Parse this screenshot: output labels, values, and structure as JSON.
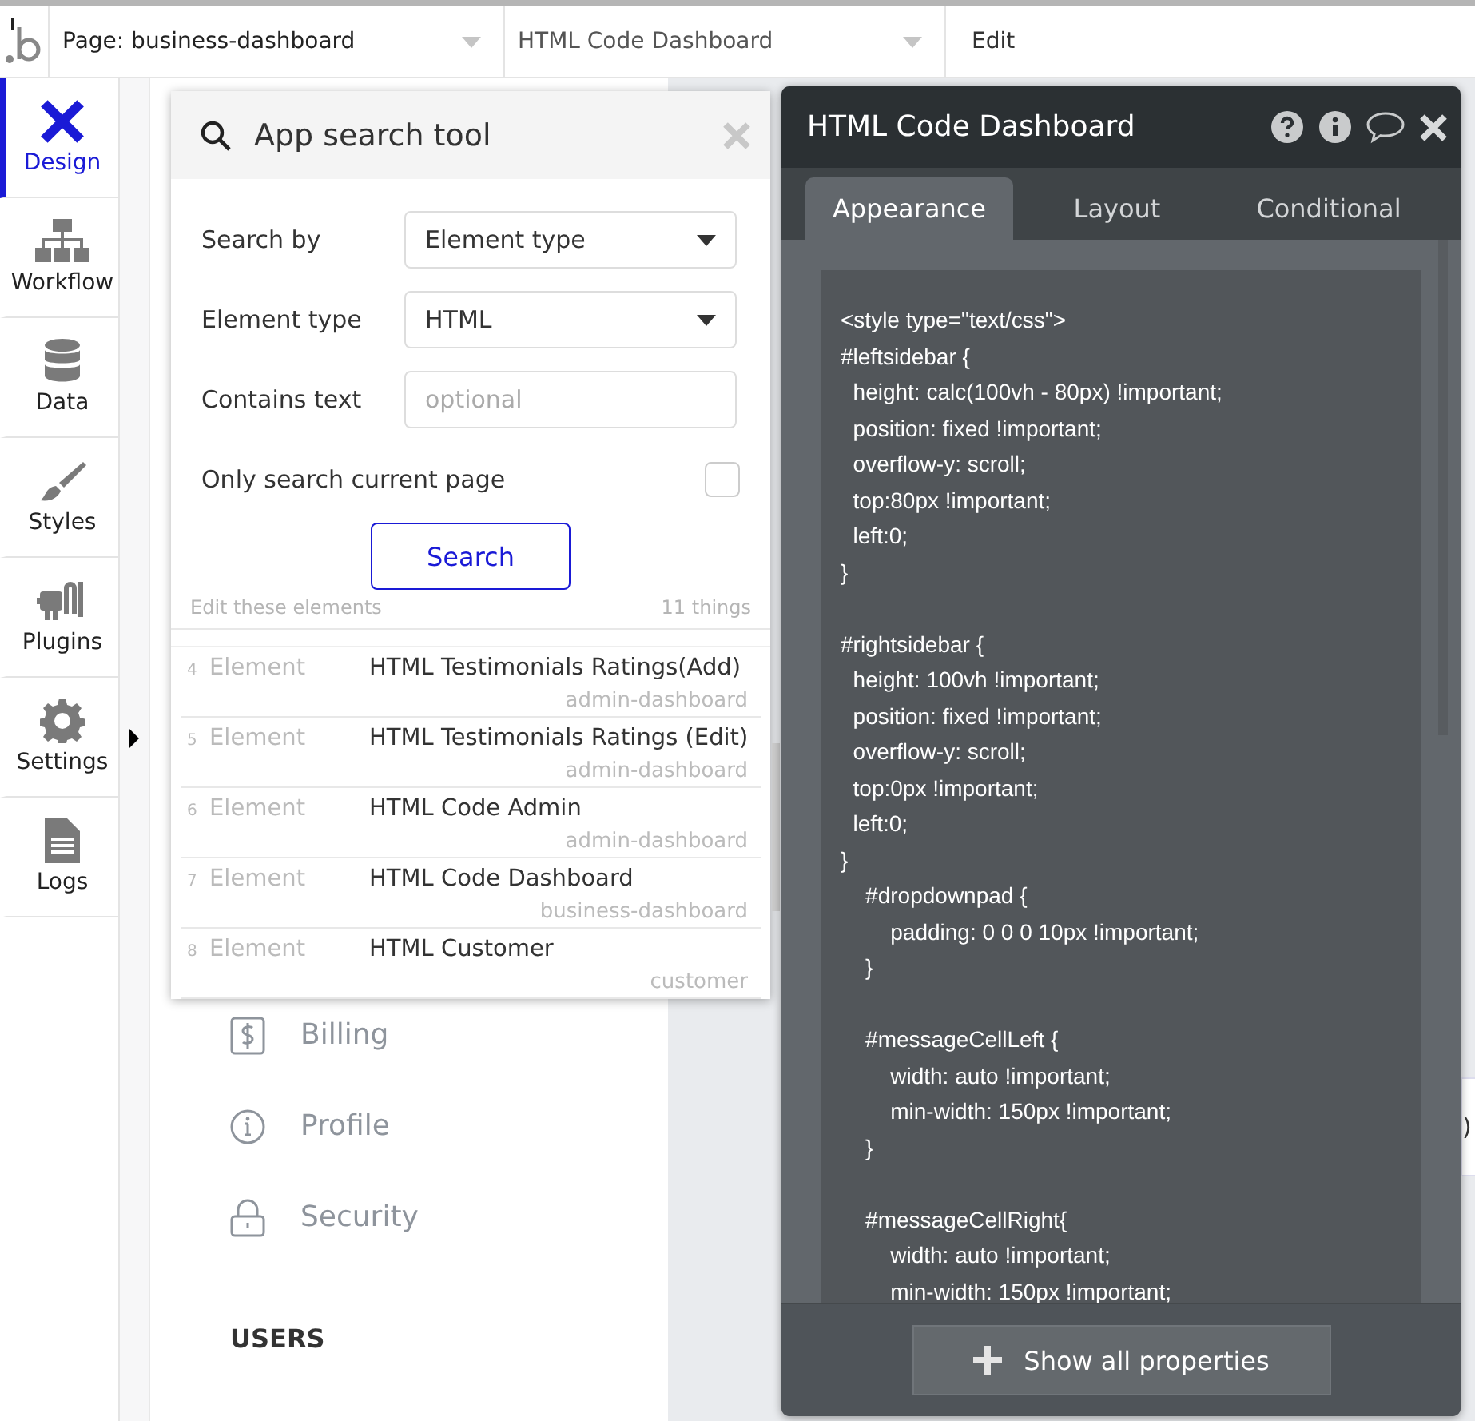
{
  "top_bar": {
    "page_selector": "Page: business-dashboard",
    "element_selector": "HTML Code Dashboard",
    "edit_menu": "Edit"
  },
  "sidebar": {
    "items": [
      {
        "label": "Design",
        "selected": true
      },
      {
        "label": "Workflow",
        "selected": false
      },
      {
        "label": "Data",
        "selected": false
      },
      {
        "label": "Styles",
        "selected": false
      },
      {
        "label": "Plugins",
        "selected": false
      },
      {
        "label": "Settings",
        "selected": false,
        "expandable": true
      },
      {
        "label": "Logs",
        "selected": false
      }
    ]
  },
  "page_nav": {
    "items": [
      {
        "label": "Billing"
      },
      {
        "label": "Profile"
      },
      {
        "label": "Security"
      }
    ],
    "section_heading": "USERS"
  },
  "right_card_fragment": ")",
  "search_tool": {
    "title": "App search tool",
    "fields": [
      {
        "label": "Search by",
        "kind": "select",
        "value": "Element type"
      },
      {
        "label": "Element type",
        "kind": "select",
        "value": "HTML"
      },
      {
        "label": "Contains text",
        "kind": "text",
        "placeholder": "optional"
      },
      {
        "label": "Only search current page",
        "kind": "checkbox",
        "checked": false
      }
    ],
    "search_button": "Search",
    "results_caption": "Edit these elements",
    "results_count": "11 things",
    "results": [
      {
        "index": "4",
        "type": "Element",
        "name": "HTML Testimonials Ratings(Add)",
        "page": "admin-dashboard"
      },
      {
        "index": "5",
        "type": "Element",
        "name": "HTML Testimonials Ratings (Edit)",
        "page": "admin-dashboard"
      },
      {
        "index": "6",
        "type": "Element",
        "name": "HTML Code Admin",
        "page": "admin-dashboard"
      },
      {
        "index": "7",
        "type": "Element",
        "name": "HTML Code Dashboard",
        "page": "business-dashboard"
      },
      {
        "index": "8",
        "type": "Element",
        "name": "HTML Customer",
        "page": "customer"
      }
    ]
  },
  "property_editor": {
    "title": "HTML Code Dashboard",
    "tabs": [
      {
        "label": "Appearance",
        "selected": true
      },
      {
        "label": "Layout",
        "selected": false
      },
      {
        "label": "Conditional",
        "selected": false
      }
    ],
    "code_blocks": [
      [
        "<style type=\"text/css\">",
        "#leftsidebar {",
        "  height: calc(100vh - 80px) !important;",
        "  position: fixed !important;",
        "  overflow-y: scroll;",
        "  top:80px !important;",
        "  left:0;",
        "}"
      ],
      [
        "#rightsidebar {",
        "  height: 100vh !important;",
        "  position: fixed !important;",
        "  overflow-y: scroll;",
        "  top:0px !important;",
        "  left:0;",
        "}",
        "    #dropdownpad {",
        "        padding: 0 0 0 10px !important;",
        "    }"
      ],
      [
        "    #messageCellLeft {",
        "        width: auto !important;",
        "        min-width: 150px !important;",
        "    }"
      ],
      [
        "    #messageCellRight{",
        "        width: auto !important;",
        "        min-width: 150px !important;"
      ]
    ],
    "show_all_button": "Show all properties"
  }
}
